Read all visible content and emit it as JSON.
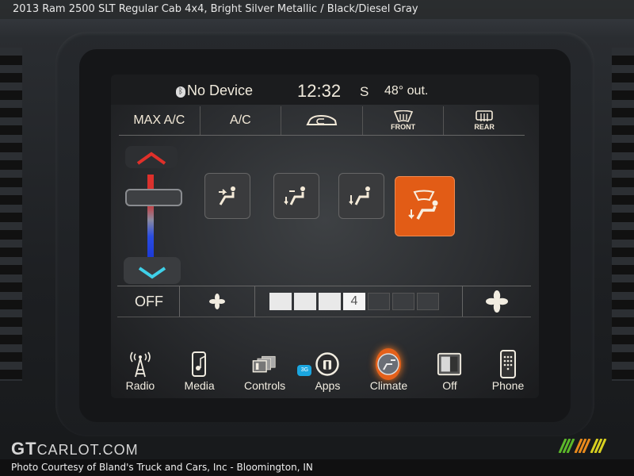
{
  "photo": {
    "title": "2013 Ram 2500 SLT Regular Cab 4x4,  Bright Silver Metallic / Black/Diesel Gray",
    "credit": "Photo Courtesy of Bland's Truck and Cars, Inc - Bloomington, IN",
    "watermark_gt": "GT",
    "watermark_rest": "CARLOT.COM"
  },
  "status": {
    "bluetooth_icon": "bluetooth-icon",
    "device": "No Device",
    "time": "12:32",
    "compass": "S",
    "outside_temp": "48° out."
  },
  "top_controls": [
    {
      "label": "MAX A/C",
      "icon": null
    },
    {
      "label": "A/C",
      "icon": null
    },
    {
      "label": "",
      "icon": "recirculation-icon"
    },
    {
      "label": "FRONT",
      "icon": "front-defrost-icon"
    },
    {
      "label": "REAR",
      "icon": "rear-defrost-icon"
    }
  ],
  "temperature": {
    "up_icon": "chevron-up-icon",
    "down_icon": "chevron-down-icon",
    "colors": {
      "hot": "#e0302a",
      "cold": "#1c3ad8",
      "cold_arrow": "#3fd0e8"
    }
  },
  "air_modes": [
    {
      "name": "panel",
      "active": false
    },
    {
      "name": "bi-level",
      "active": false
    },
    {
      "name": "floor",
      "active": false
    },
    {
      "name": "floor-defrost",
      "active": true
    }
  ],
  "fan": {
    "off_label": "OFF",
    "speed": 4,
    "max_speed": 7,
    "speed_label": "4"
  },
  "nav": [
    {
      "label": "Radio",
      "icon": "radio-tower-icon"
    },
    {
      "label": "Media",
      "icon": "media-icon"
    },
    {
      "label": "Controls",
      "icon": "controls-icon"
    },
    {
      "label": "Apps",
      "icon": "apps-icon",
      "badge": "3G"
    },
    {
      "label": "Climate",
      "icon": "climate-icon",
      "active": true
    },
    {
      "label": "Off",
      "icon": "screen-off-icon"
    },
    {
      "label": "Phone",
      "icon": "phone-icon"
    }
  ],
  "colors": {
    "accent": "#e25c16",
    "text": "#f1ece0"
  }
}
